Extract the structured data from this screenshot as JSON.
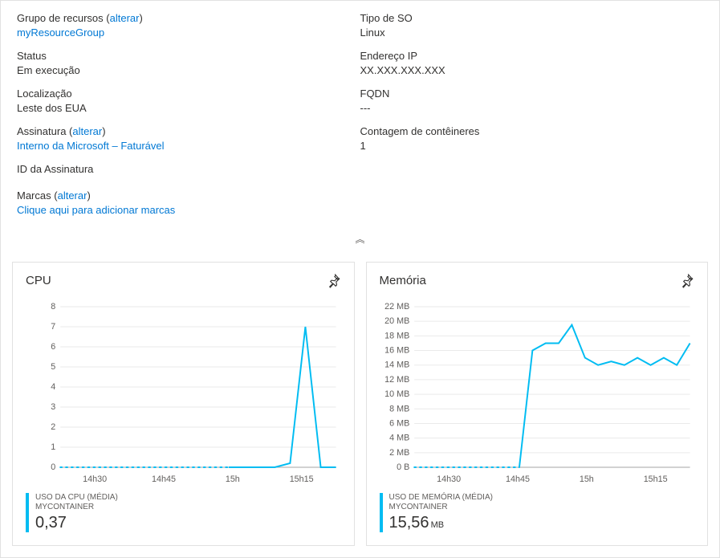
{
  "properties": {
    "left": [
      {
        "label": "Grupo de recursos",
        "paren": "alterar",
        "link_value": "myResourceGroup"
      },
      {
        "label": "Status",
        "value": "Em execução"
      },
      {
        "label": "Localização",
        "value": "Leste dos EUA"
      },
      {
        "label": "Assinatura",
        "paren": "alterar",
        "link_value": "Interno da Microsoft – Faturável"
      },
      {
        "label": "ID da Assinatura",
        "value": ""
      }
    ],
    "right": [
      {
        "label": "Tipo de SO",
        "value": "Linux"
      },
      {
        "label": "Endereço IP",
        "value": "XX.XXX.XXX.XXX"
      },
      {
        "label": "FQDN",
        "value": "---"
      },
      {
        "label": "Contagem de contêineres",
        "value": "1"
      }
    ]
  },
  "tags": {
    "label": "Marcas",
    "paren": "alterar",
    "link_value": "Clique aqui para adicionar marcas"
  },
  "collapse_glyph": "︽",
  "cpu_card": {
    "title": "CPU",
    "legend_label": "USO DA CPU (MÉDIA)",
    "legend_sub": "MYCONTAINER",
    "legend_value": "0,37",
    "legend_unit": ""
  },
  "mem_card": {
    "title": "Memória",
    "legend_label": "USO DE MEMÓRIA (MÉDIA)",
    "legend_sub": "MYCONTAINER",
    "legend_value": "15,56",
    "legend_unit": "MB"
  },
  "chart_data": [
    {
      "type": "line",
      "title": "CPU",
      "ylabel": "",
      "xlabel": "",
      "ylim": [
        0,
        8
      ],
      "y_ticks": [
        0,
        1,
        2,
        3,
        4,
        5,
        6,
        7,
        8
      ],
      "x_ticks": [
        "14h30",
        "14h45",
        "15h",
        "15h15"
      ],
      "x": [
        0,
        1,
        2,
        3,
        4,
        5,
        6,
        7,
        8,
        9,
        10,
        11,
        12,
        13,
        14,
        15,
        16,
        17,
        18
      ],
      "values": [
        0,
        0,
        0,
        0,
        0,
        0,
        0,
        0,
        0,
        0,
        0,
        0,
        0,
        0,
        0,
        0.2,
        7,
        0,
        0
      ],
      "dashed_until_index": 11,
      "series_name": "USO DA CPU (MÉDIA) MYCONTAINER"
    },
    {
      "type": "line",
      "title": "Memória",
      "ylabel": "",
      "xlabel": "",
      "ylim": [
        0,
        22
      ],
      "y_ticks": [
        "0 B",
        "2 MB",
        "4 MB",
        "6 MB",
        "8 MB",
        "10 MB",
        "12 MB",
        "14 MB",
        "16 MB",
        "18 MB",
        "20 MB",
        "22 MB"
      ],
      "x_ticks": [
        "14h30",
        "14h45",
        "15h",
        "15h15"
      ],
      "x": [
        0,
        1,
        2,
        3,
        4,
        5,
        6,
        7,
        8,
        9,
        10,
        11,
        12,
        13,
        14,
        15,
        16,
        17,
        18,
        19,
        20,
        21
      ],
      "values": [
        0,
        0,
        0,
        0,
        0,
        0,
        0,
        0,
        0,
        16,
        17,
        17,
        19.5,
        15,
        14,
        14.5,
        14,
        15,
        14,
        15,
        14,
        17
      ],
      "dashed_until_index": 8,
      "series_name": "USO DE MEMÓRIA (MÉDIA) MYCONTAINER"
    }
  ]
}
